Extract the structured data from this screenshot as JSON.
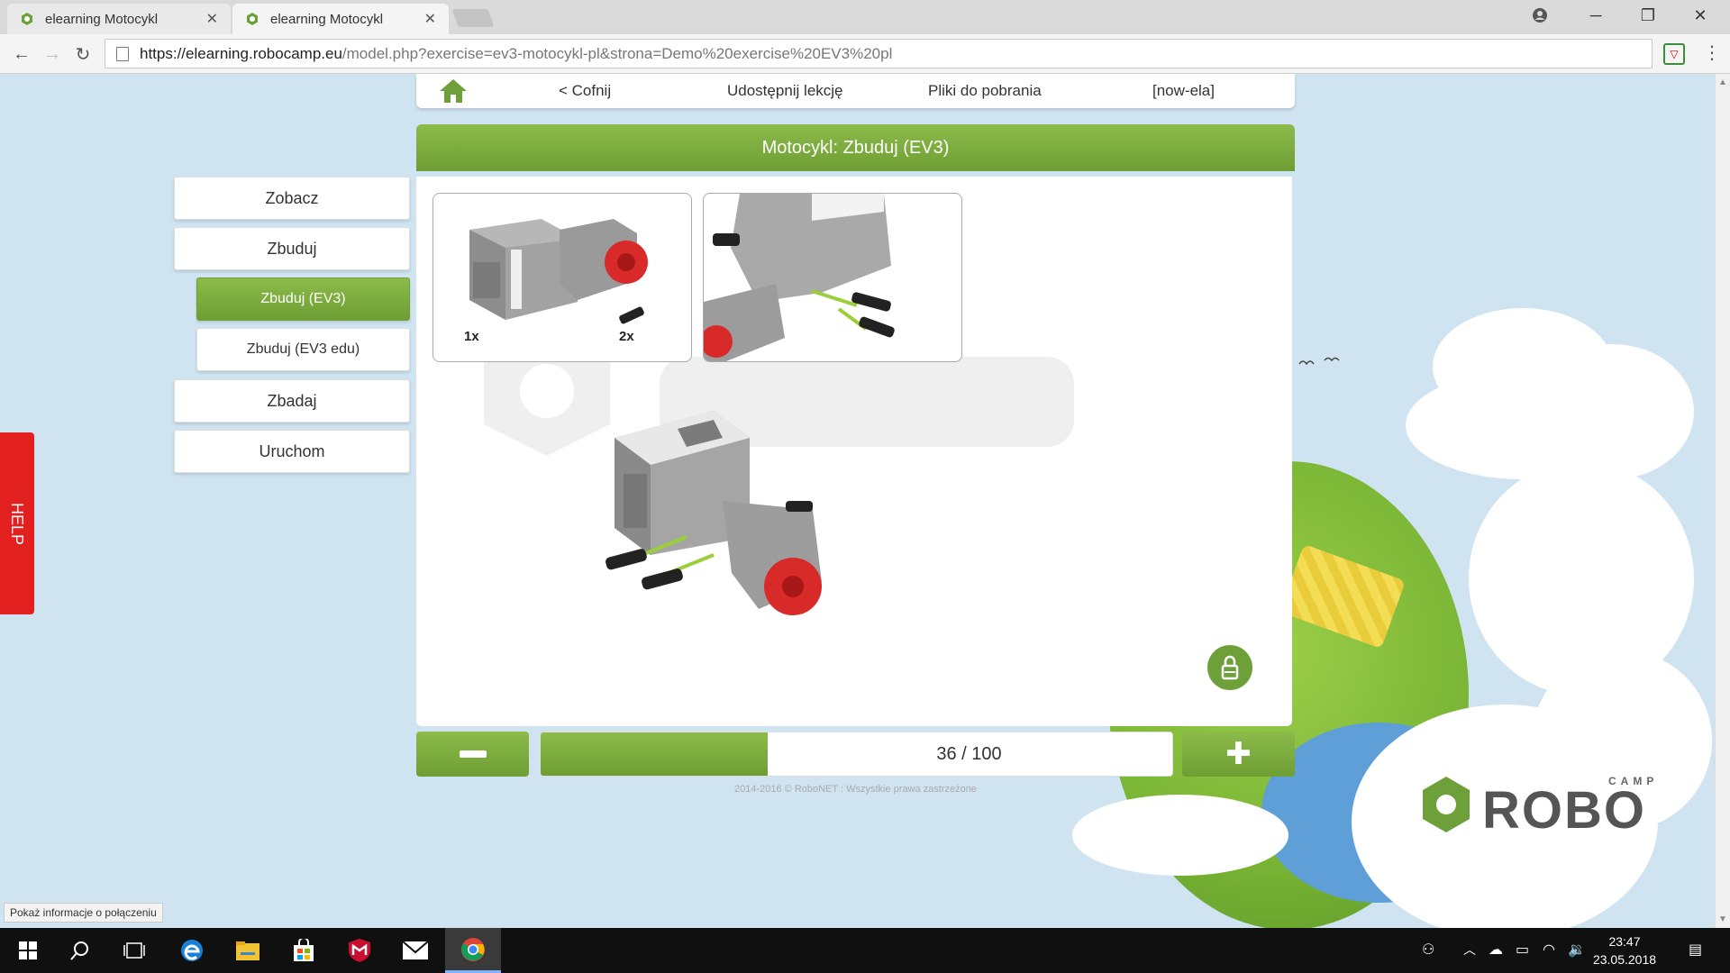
{
  "browser": {
    "tabs": [
      {
        "title": "elearning Motocykl",
        "active": false
      },
      {
        "title": "elearning Motocykl",
        "active": true
      }
    ],
    "url_host": "https://elearning.robocamp.eu",
    "url_path": "/model.php?exercise=ev3-motocykl-pl&strona=Demo%20exercise%20EV3%20pl"
  },
  "topnav": {
    "back": "< Cofnij",
    "share": "Udostępnij lekcję",
    "downloads": "Pliki do pobrania",
    "user": "[now-ela]"
  },
  "lesson": {
    "title": "Motocykl: Zbuduj (EV3)"
  },
  "sidebar": {
    "items": [
      {
        "label": "Zobacz"
      },
      {
        "label": "Zbuduj"
      },
      {
        "label": "Zbuduj (EV3)"
      },
      {
        "label": "Zbuduj (EV3 edu)"
      },
      {
        "label": "Zbadaj"
      },
      {
        "label": "Uruchom"
      }
    ]
  },
  "help": {
    "label": "HELP"
  },
  "step": {
    "parts": [
      {
        "qty": "1x"
      },
      {
        "qty": "2x"
      }
    ]
  },
  "pager": {
    "current": 36,
    "total": 100,
    "text": "36 / 100"
  },
  "footer": {
    "copyright": "2014-2016 © RoboNET : Wszystkie prawa zastrzeżone",
    "status": "Pokaż informacje o połączeniu"
  },
  "logo": {
    "camp": "CAMP",
    "robo": "ROBO"
  },
  "taskbar": {
    "time": "23:47",
    "date": "23.05.2018"
  },
  "colors": {
    "accent": "#7aac3c",
    "help": "#e32020"
  }
}
